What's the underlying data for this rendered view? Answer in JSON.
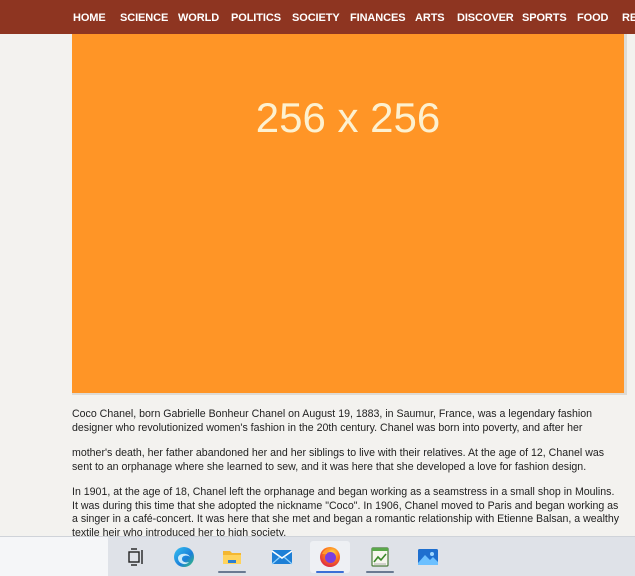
{
  "nav": {
    "items": [
      "HOME",
      "SCIENCE",
      "WORLD",
      "POLITICS",
      "SOCIETY",
      "FINANCES",
      "ARTS",
      "DISCOVER",
      "SPORTS",
      "FOOD",
      "RE"
    ]
  },
  "hero": {
    "placeholder_label": "256 x 256"
  },
  "article": {
    "paragraphs": [
      "Coco Chanel, born Gabrielle Bonheur Chanel on August 19, 1883, in Saumur, France, was a legendary fashion designer who revolutionized women's fashion in the 20th century. Chanel was born into poverty, and after her",
      "mother's death, her father abandoned her and her siblings to live with their relatives. At the age of 12, Chanel was sent to an orphanage where she learned to sew, and it was here that she developed a love for fashion design.",
      "In 1901, at the age of 18, Chanel left the orphanage and began working as a seamstress in a small shop in Moulins. It was during this time that she adopted the nickname \"Coco\". In 1906, Chanel moved to Paris and began working as a singer in a café-concert. It was here that she met and began a romantic relationship with Etienne Balsan, a wealthy textile heir who introduced her to high society."
    ]
  },
  "taskbar": {
    "apps": [
      {
        "icon": "task-view-icon"
      },
      {
        "icon": "edge-browser-icon"
      },
      {
        "icon": "file-explorer-icon"
      },
      {
        "icon": "mail-icon"
      },
      {
        "icon": "firefox-icon",
        "active": true
      },
      {
        "icon": "notepad-chart-icon"
      },
      {
        "icon": "photos-icon"
      }
    ]
  },
  "colors": {
    "nav_bg": "#8e3521",
    "hero_bg": "#ff9526",
    "page_bg": "#f3f2ef",
    "taskbar_bg": "#dfe2e8"
  }
}
